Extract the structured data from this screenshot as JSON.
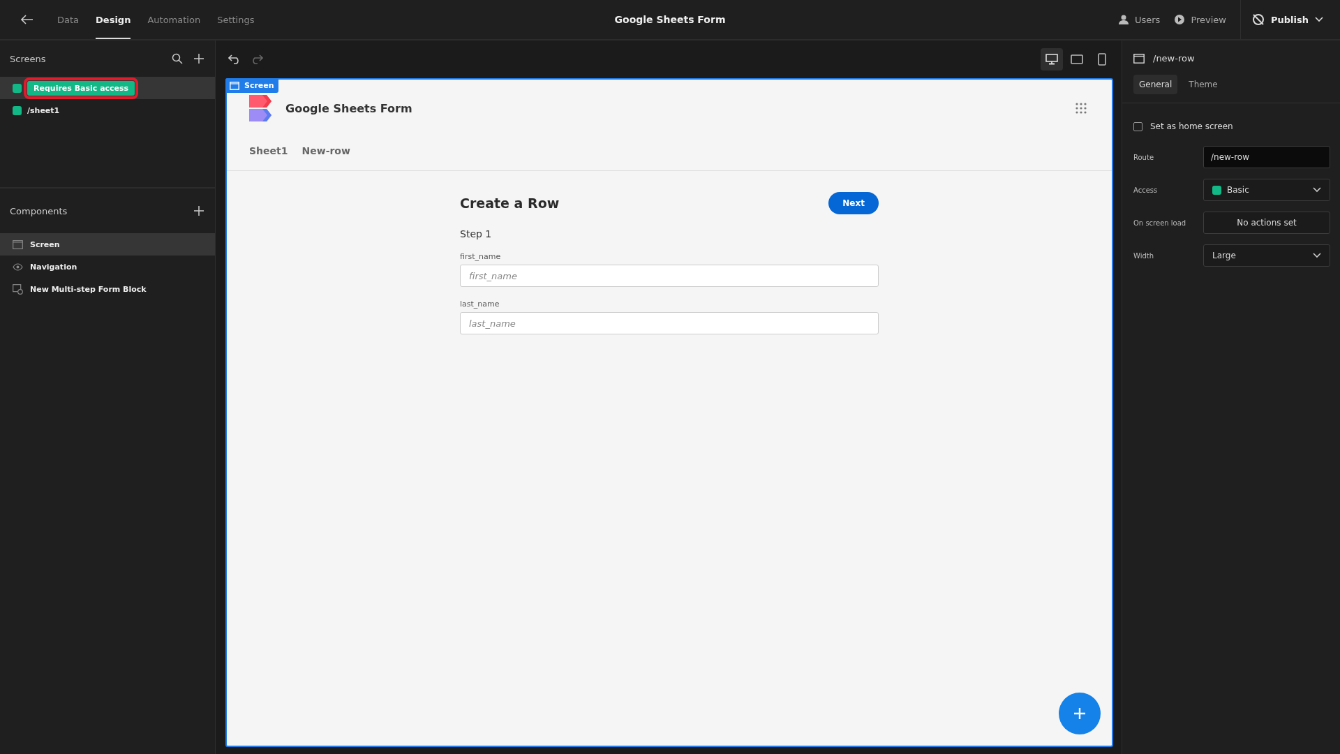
{
  "top_nav": {
    "tabs": [
      {
        "label": "Data",
        "selected": false
      },
      {
        "label": "Design",
        "selected": true
      },
      {
        "label": "Automation",
        "selected": false
      },
      {
        "label": "Settings",
        "selected": false
      }
    ],
    "title": "Google Sheets Form",
    "actions": [
      {
        "label": "Users",
        "kind": "users"
      },
      {
        "label": "Preview",
        "kind": "preview"
      }
    ],
    "publish": "Publish"
  },
  "screens": {
    "title": "Screens",
    "items": [
      {
        "selected": true,
        "color": "#12b886",
        "tooltip": "Requires Basic access"
      },
      {
        "route": "/sheet1",
        "selected": false,
        "color": "#12b886"
      }
    ]
  },
  "components": {
    "title": "Components",
    "items": [
      {
        "label": "Screen",
        "kind": "screen",
        "selected": true
      },
      {
        "label": "Navigation",
        "kind": "navigation",
        "selected": false
      },
      {
        "label": "New Multi-step Form Block",
        "kind": "form",
        "selected": false
      }
    ]
  },
  "device_buttons": [
    {
      "kind": "desktop",
      "selected": true
    },
    {
      "kind": "tablet",
      "selected": false
    },
    {
      "kind": "mobile",
      "selected": false
    }
  ],
  "preview": {
    "badge": "Screen",
    "app_title": "Google Sheets Form",
    "nav_links": [
      "Sheet1",
      "New-row"
    ],
    "form": {
      "title": "Create a Row",
      "button": "Next",
      "step": "Step 1",
      "fields": [
        {
          "label": "first_name",
          "placeholder": "first_name"
        },
        {
          "label": "last_name",
          "placeholder": "last_name"
        }
      ]
    }
  },
  "settings": {
    "screen": "/new-row",
    "tabs": [
      {
        "label": "General",
        "selected": true
      },
      {
        "label": "Theme",
        "selected": false
      }
    ],
    "home_screen": {
      "label": "Set as home screen",
      "checked": false
    },
    "rows": [
      {
        "label": "Route",
        "kind": "input",
        "value": "/new-row"
      },
      {
        "label": "Access",
        "kind": "select",
        "value": "Basic",
        "color": "#12b886"
      },
      {
        "label": "On screen load",
        "kind": "button",
        "value": "No actions set"
      },
      {
        "label": "Width",
        "kind": "select",
        "value": "Large"
      }
    ]
  }
}
